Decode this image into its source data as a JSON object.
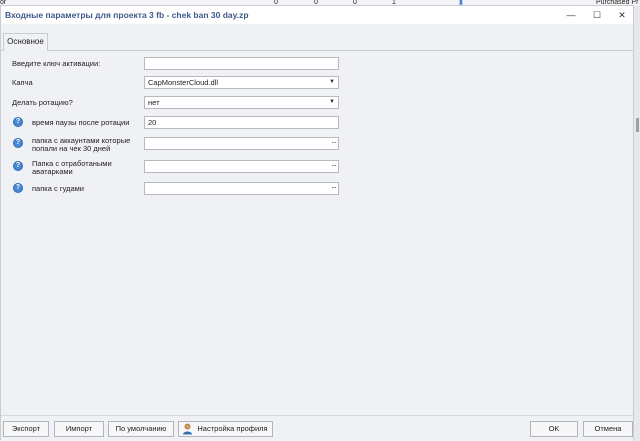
{
  "background": {
    "left_text": "or",
    "cols": [
      "0",
      "0",
      "0",
      "1"
    ],
    "right_text": "Purchased Pr"
  },
  "window": {
    "title": "Входные параметры для проекта 3 fb - chek ban 30 day.zp",
    "minimize": "—",
    "maximize": "☐",
    "close": "✕"
  },
  "tabs": [
    {
      "label": "Основное"
    }
  ],
  "fields": [
    {
      "label": "Введите ключ активации:",
      "value": "",
      "has_help": false,
      "control": "text"
    },
    {
      "label": "Капча",
      "value": "CapMonsterCloud.dll",
      "has_help": false,
      "control": "dropdown"
    },
    {
      "label": "Делать ротацию?",
      "value": "нет",
      "has_help": false,
      "control": "dropdown"
    },
    {
      "label": "время паузы после ротации",
      "value": "20",
      "has_help": true,
      "control": "text"
    },
    {
      "label": "папка с аккаунтами которые попали на чек 30 дней",
      "value": "",
      "has_help": true,
      "control": "browse"
    },
    {
      "label": "Папка с отработаными аватарками",
      "value": "",
      "has_help": true,
      "control": "browse"
    },
    {
      "label": "папка с гудами",
      "value": "",
      "has_help": true,
      "control": "browse"
    }
  ],
  "footer": {
    "export": "Экспорт",
    "import": "Импорт",
    "default": "По умолчанию",
    "profile": "Настройка профиля",
    "ok": "OK",
    "cancel": "Отмена"
  },
  "colors": {
    "title": "#3d5a8a",
    "help_icon": "#4a87d4",
    "window_bg": "#f0f1f4"
  }
}
